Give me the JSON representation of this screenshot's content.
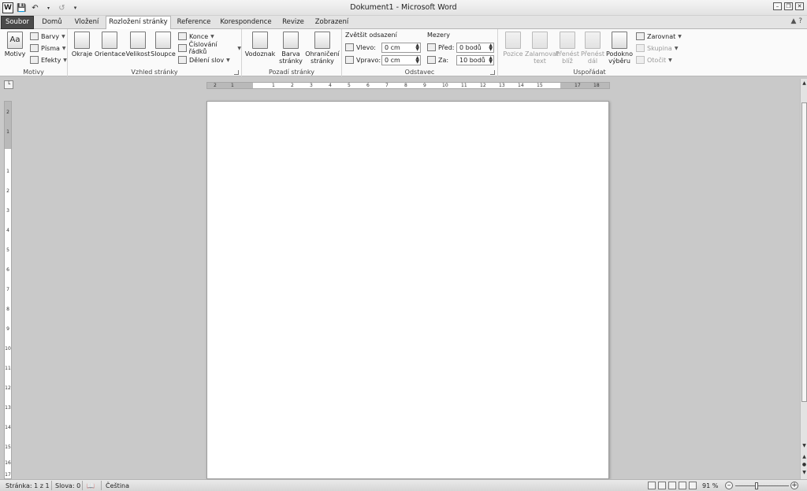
{
  "window": {
    "title": "Dokument1 - Microsoft Word",
    "app_icon_letter": "W"
  },
  "tabs": [
    "Soubor",
    "Domů",
    "Vložení",
    "Rozložení stránky",
    "Reference",
    "Korespondence",
    "Revize",
    "Zobrazení"
  ],
  "active_tab": "Rozložení stránky",
  "ribbon": {
    "motivy": {
      "group_label": "Motivy",
      "motivy_label": "Motivy",
      "barvy": "Barvy",
      "pisma": "Písma",
      "efekty": "Efekty"
    },
    "vzhled": {
      "group_label": "Vzhled stránky",
      "okraje": "Okraje",
      "orientace": "Orientace",
      "velikost": "Velikost",
      "sloupce": "Sloupce",
      "konce": "Konce",
      "cislovani": "Číslování řádků",
      "deleni": "Dělení slov"
    },
    "pozadi": {
      "group_label": "Pozadí stránky",
      "vodoznak": "Vodoznak",
      "barva_1": "Barva",
      "barva_2": "stránky",
      "ohraniceni_1": "Ohraničení",
      "ohraniceni_2": "stránky"
    },
    "odstavec": {
      "group_label": "Odstavec",
      "indent_title": "Zvětšit odsazení",
      "vlevo_label": "Vlevo:",
      "vlevo_value": "0 cm",
      "vpravo_label": "Vpravo:",
      "vpravo_value": "0 cm",
      "spacing_title": "Mezery",
      "pred_label": "Před:",
      "pred_value": "0 bodů",
      "za_label": "Za:",
      "za_value": "10 bodů"
    },
    "usporadat": {
      "group_label": "Uspořádat",
      "pozice": "Pozice",
      "zalamovat_1": "Zalamovat",
      "zalamovat_2": "text",
      "prenest_bliz_1": "Přenést",
      "prenest_bliz_2": "blíž",
      "prenest_dal_1": "Přenést",
      "prenest_dal_2": "dál",
      "podokno_1": "Podokno",
      "podokno_2": "výběru",
      "zarovnat": "Zarovnat",
      "skupina": "Skupina",
      "otocit": "Otočit"
    }
  },
  "ruler_h_ticks": [
    "2",
    "1",
    "1",
    "2",
    "3",
    "4",
    "5",
    "6",
    "7",
    "8",
    "9",
    "10",
    "11",
    "12",
    "13",
    "14",
    "15",
    "17",
    "18"
  ],
  "ruler_v_ticks": [
    "2",
    "1",
    "1",
    "2",
    "3",
    "4",
    "5",
    "6",
    "7",
    "8",
    "9",
    "10",
    "11",
    "12",
    "13",
    "14",
    "15",
    "16",
    "17"
  ],
  "status": {
    "page": "Stránka: 1 z 1",
    "words": "Slova: 0",
    "language": "Čeština",
    "zoom": "91 %"
  }
}
